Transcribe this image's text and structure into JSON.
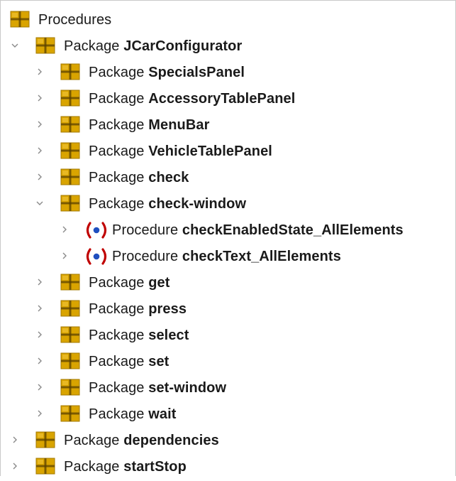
{
  "tree": {
    "root": {
      "label": "Procedures",
      "icon": "package-icon"
    },
    "items": [
      {
        "kind": "Package",
        "name": "JCarConfigurator",
        "level": 1,
        "state": "expanded"
      },
      {
        "kind": "Package",
        "name": "SpecialsPanel",
        "level": 2,
        "state": "collapsed"
      },
      {
        "kind": "Package",
        "name": "AccessoryTablePanel",
        "level": 2,
        "state": "collapsed"
      },
      {
        "kind": "Package",
        "name": "MenuBar",
        "level": 2,
        "state": "collapsed"
      },
      {
        "kind": "Package",
        "name": "VehicleTablePanel",
        "level": 2,
        "state": "collapsed"
      },
      {
        "kind": "Package",
        "name": "check",
        "level": 2,
        "state": "collapsed"
      },
      {
        "kind": "Package",
        "name": "check-window",
        "level": 2,
        "state": "expanded"
      },
      {
        "kind": "Procedure",
        "name": "checkEnabledState_AllElements",
        "level": 3,
        "state": "collapsed"
      },
      {
        "kind": "Procedure",
        "name": "checkText_AllElements",
        "level": 3,
        "state": "collapsed"
      },
      {
        "kind": "Package",
        "name": "get",
        "level": 2,
        "state": "collapsed"
      },
      {
        "kind": "Package",
        "name": "press",
        "level": 2,
        "state": "collapsed"
      },
      {
        "kind": "Package",
        "name": "select",
        "level": 2,
        "state": "collapsed"
      },
      {
        "kind": "Package",
        "name": "set",
        "level": 2,
        "state": "collapsed"
      },
      {
        "kind": "Package",
        "name": "set-window",
        "level": 2,
        "state": "collapsed"
      },
      {
        "kind": "Package",
        "name": "wait",
        "level": 2,
        "state": "collapsed"
      },
      {
        "kind": "Package",
        "name": "dependencies",
        "level": 1,
        "state": "collapsed"
      },
      {
        "kind": "Package",
        "name": "startStop",
        "level": 1,
        "state": "collapsed"
      }
    ]
  },
  "colors": {
    "package_icon": "#d9a400",
    "package_icon_dark": "#a37a00",
    "procedure_paren": "#c00000",
    "procedure_dot": "#1f4fbf",
    "chevron": "#8a8a8a"
  },
  "icons": {
    "package": "package-icon",
    "procedure": "procedure-icon",
    "expanded": "chevron-down-icon",
    "collapsed": "chevron-right-icon"
  }
}
